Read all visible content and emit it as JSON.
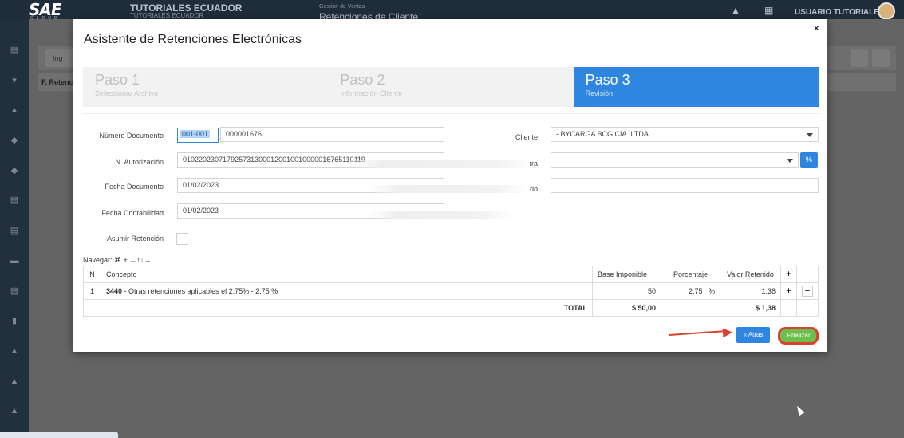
{
  "app": {
    "logo": "SAE",
    "logo_sub": "CLOUD",
    "company": "TUTORIALES ECUADOR",
    "company_sub": "TUTORIALES ECUADOR",
    "module": "Gestión de Ventas",
    "page": "Retenciones de Cliente",
    "user": "USUARIO TUTORIALES"
  },
  "background": {
    "toolbar_button": "Ing",
    "table_header": "F. Retenc"
  },
  "modal": {
    "title": "Asistente de Retenciones Electrónicas",
    "close": "×",
    "steps": [
      {
        "title": "Paso 1",
        "subtitle": "Seleccionar Archivo",
        "active": false
      },
      {
        "title": "Paso 2",
        "subtitle": "Información Cliente",
        "active": false
      },
      {
        "title": "Paso 3",
        "subtitle": "Revisión",
        "active": true
      }
    ],
    "form": {
      "numero_documento_label": "Número Documento",
      "numero_documento_serie": "001-001",
      "numero_documento_secuencial": "000001676",
      "autorizacion_label": "N. Autorización",
      "autorizacion_value": "0102202307179257313000120010010000016765110119",
      "fecha_documento_label": "Fecha Documento",
      "fecha_documento_value": "01/02/2023",
      "fecha_contabilidad_label": "Fecha Contabilidad",
      "fecha_contabilidad_value": "01/02/2023",
      "asumir_label": "Asumir Retención",
      "cliente_label": "Cliente",
      "cliente_value": "- BYCARGA BCG CIA. LTDA.",
      "factura_label_partial": "ıra",
      "usuario_label_partial": "rio",
      "link_icon": "%"
    },
    "nav_hint": "Navegar: ⌘ + ←↑↓→",
    "table": {
      "headers": [
        "N",
        "Concepto",
        "Base Imponible",
        "Porcentaje",
        "Valor Retenido"
      ],
      "rows": [
        {
          "n": "1",
          "code": "3440",
          "concept": " - Otras retenciones aplicables el 2.75% - 2.75 %",
          "base": "50",
          "pct": "2,75",
          "pct_unit": "%",
          "valor": "1.38"
        }
      ],
      "total_label": "TOTAL",
      "total_base": "$ 50,00",
      "total_valor": "$ 1,38",
      "add_symbol": "+",
      "remove_symbol": "−"
    },
    "buttons": {
      "atras": "« Atras",
      "finalizar": "Finalizar"
    }
  },
  "colors": {
    "accent": "#2e86e0",
    "success": "#6cbf4a",
    "highlight": "#d9412f"
  }
}
